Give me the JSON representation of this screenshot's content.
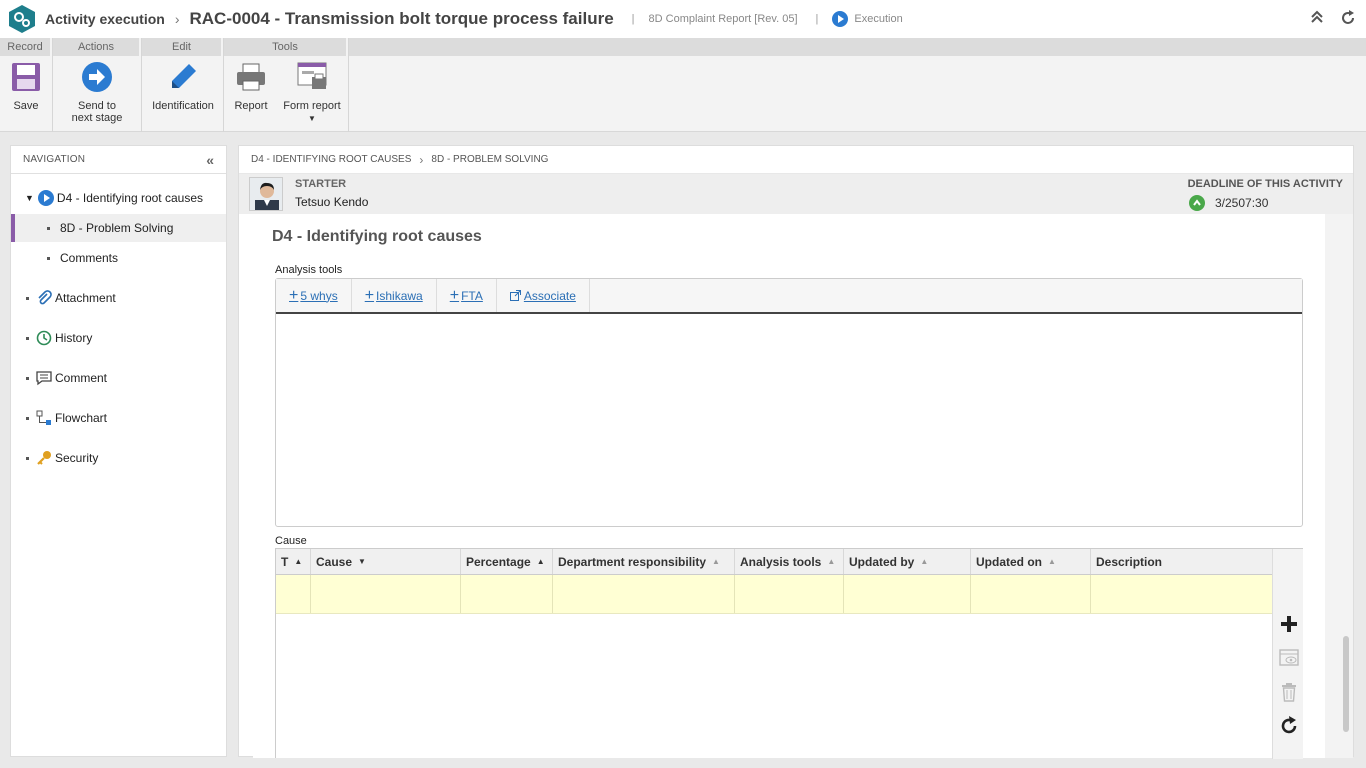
{
  "header": {
    "app_name": "Activity execution",
    "separator": "›",
    "document_title": "RAC-0004 - Transmission bolt torque process failure",
    "form_name": "8D Complaint Report [Rev. 05]",
    "status": "Execution",
    "pipe": "|"
  },
  "ribbon": {
    "groups": [
      {
        "title": "Record",
        "buttons": [
          {
            "label": "Save",
            "icon": "save-icon"
          }
        ]
      },
      {
        "title": "Actions",
        "buttons": [
          {
            "label": "Send to\nnext stage",
            "icon": "send-next-stage-icon"
          }
        ]
      },
      {
        "title": "Edit",
        "buttons": [
          {
            "label": "Identification",
            "icon": "pencil-icon"
          }
        ]
      },
      {
        "title": "Tools",
        "buttons": [
          {
            "label": "Report",
            "icon": "printer-icon"
          },
          {
            "label": "Form report",
            "icon": "form-report-icon"
          }
        ]
      }
    ],
    "send_line1": "Send to",
    "send_line2": "next stage"
  },
  "navigation": {
    "title": "NAVIGATION",
    "items": [
      {
        "label": "D4 - Identifying root causes",
        "icon": "play-circle-icon"
      },
      {
        "label": "8D - Problem Solving"
      },
      {
        "label": "Comments"
      },
      {
        "label": "Attachment",
        "icon": "paperclip-icon"
      },
      {
        "label": "History",
        "icon": "history-icon"
      },
      {
        "label": "Comment",
        "icon": "comment-icon"
      },
      {
        "label": "Flowchart",
        "icon": "flowchart-icon"
      },
      {
        "label": "Security",
        "icon": "key-icon"
      }
    ]
  },
  "main": {
    "breadcrumb": [
      "D4 - IDENTIFYING ROOT CAUSES",
      "8D - PROBLEM SOLVING"
    ],
    "starter_label": "STARTER",
    "starter_name": "Tetsuo Kendo",
    "deadline_label": "DEADLINE OF THIS ACTIVITY",
    "deadline_value": "3/2507:30",
    "section_title": "D4 - Identifying root causes",
    "analysis_tools_label": "Analysis tools",
    "analysis_tools": [
      {
        "label": "5 whys",
        "icon": "plus-icon"
      },
      {
        "label": "Ishikawa",
        "icon": "plus-icon"
      },
      {
        "label": "FTA",
        "icon": "plus-icon"
      },
      {
        "label": "Associate",
        "icon": "external-link-icon"
      }
    ],
    "cause_label": "Cause",
    "cause_columns": [
      "T",
      "Cause",
      "Percentage",
      "Department responsibility",
      "Analysis tools",
      "Updated by",
      "Updated on",
      "Description"
    ],
    "cause_rows": [
      [
        "",
        "",
        "",
        "",
        "",
        "",
        "",
        ""
      ]
    ],
    "side_tools": [
      "add-icon",
      "view-icon",
      "delete-icon",
      "refresh-icon"
    ]
  },
  "colors": {
    "accent_purple": "#8a5ca8",
    "status_blue": "#2b7bd1",
    "link_blue": "#2b6fb5",
    "deadline_green": "#4aa84a",
    "row_highlight": "#ffffd4"
  }
}
